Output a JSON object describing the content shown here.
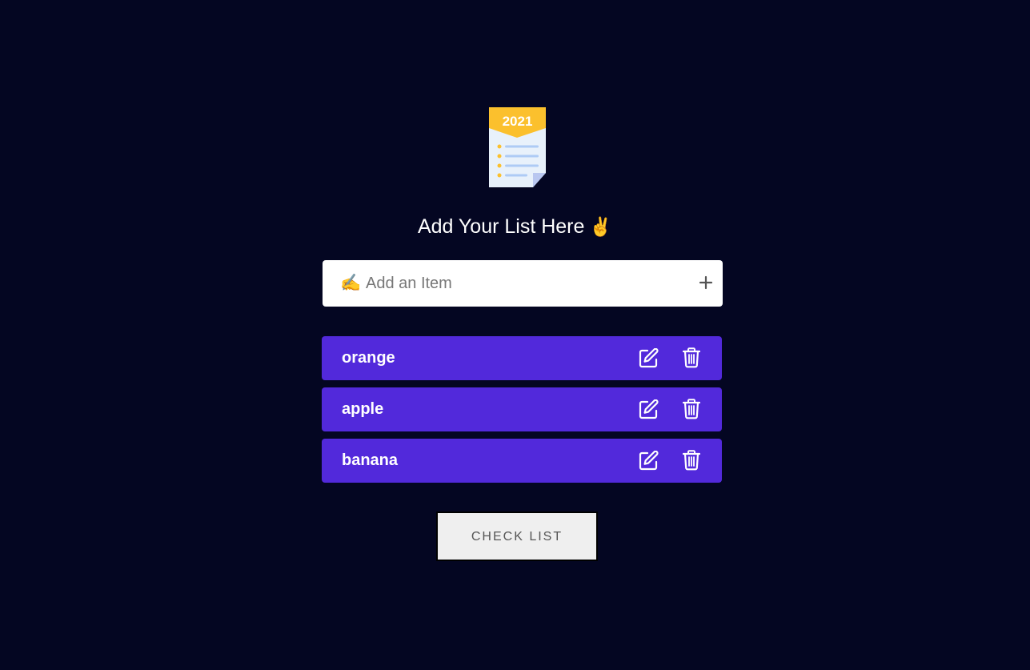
{
  "logo": {
    "badge_text": "2021",
    "icon": "checklist-document-icon"
  },
  "heading": {
    "text": "Add Your List Here",
    "emoji": "✌️"
  },
  "add_item": {
    "pen_emoji": "✍️",
    "placeholder": "Add an Item",
    "value": "",
    "add_icon": "plus-icon"
  },
  "items": [
    {
      "label": "orange",
      "edit_icon": "edit-icon",
      "delete_icon": "trash-icon"
    },
    {
      "label": "apple",
      "edit_icon": "edit-icon",
      "delete_icon": "trash-icon"
    },
    {
      "label": "banana",
      "edit_icon": "edit-icon",
      "delete_icon": "trash-icon"
    }
  ],
  "check_button": {
    "label": "CHECK LIST"
  },
  "colors": {
    "background": "#040622",
    "item_background": "#5229db",
    "badge": "#fbc02d",
    "button_background": "#efefef"
  }
}
